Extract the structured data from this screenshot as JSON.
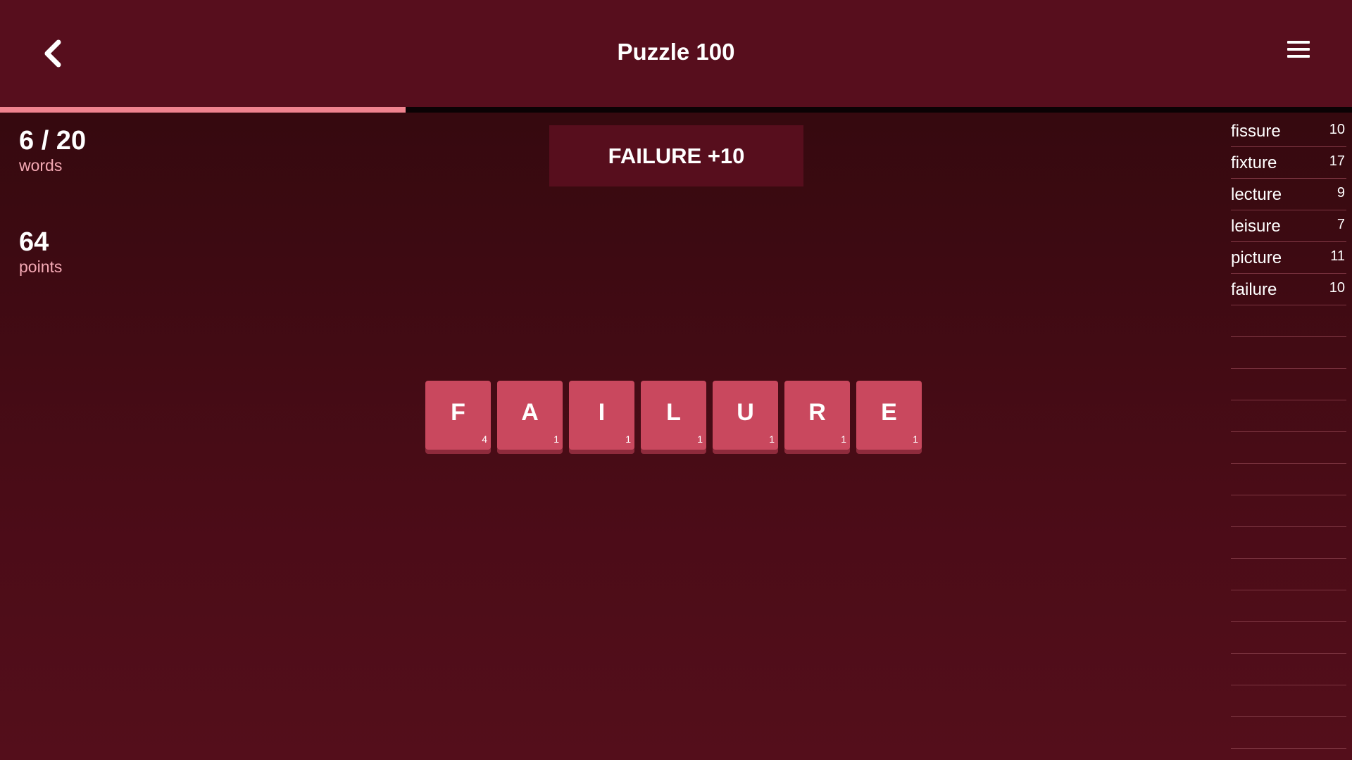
{
  "header": {
    "title": "Puzzle 100",
    "back_icon": "chevron-left-icon",
    "menu_icon": "hamburger-menu-icon"
  },
  "progress": {
    "found": 6,
    "total": 20,
    "fraction": 0.3
  },
  "stats": {
    "words_value": "6 / 20",
    "words_label": "words",
    "points_value": "64",
    "points_label": "points"
  },
  "toast": {
    "text": "FAILURE +10"
  },
  "tiles": [
    {
      "letter": "F",
      "score": "4"
    },
    {
      "letter": "A",
      "score": "1"
    },
    {
      "letter": "I",
      "score": "1"
    },
    {
      "letter": "L",
      "score": "1"
    },
    {
      "letter": "U",
      "score": "1"
    },
    {
      "letter": "R",
      "score": "1"
    },
    {
      "letter": "E",
      "score": "1"
    }
  ],
  "word_list": {
    "found": [
      {
        "word": "fissure",
        "points": "10"
      },
      {
        "word": "fixture",
        "points": "17"
      },
      {
        "word": "lecture",
        "points": "9"
      },
      {
        "word": "leisure",
        "points": "7"
      },
      {
        "word": "picture",
        "points": "11"
      },
      {
        "word": "failure",
        "points": "10"
      }
    ],
    "total_slots": 20
  },
  "colors": {
    "header_bg": "#570e1d",
    "progress_fill": "#f0838f",
    "tile_bg": "#c9485e",
    "label_pink": "#f4a9b4"
  }
}
